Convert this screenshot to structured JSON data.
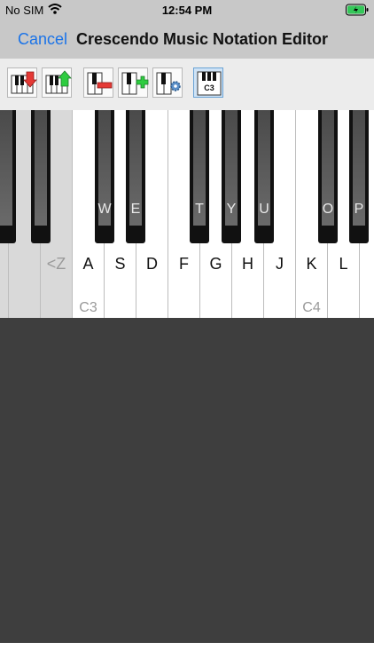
{
  "status": {
    "carrier": "No SIM",
    "time": "12:54 PM"
  },
  "nav": {
    "cancel": "Cancel",
    "title": "Crescendo Music Notation Editor"
  },
  "toolbar": {
    "buttons": [
      {
        "icon": "piano-down-icon"
      },
      {
        "icon": "piano-up-icon"
      },
      {
        "icon": "piano-remove-icon"
      },
      {
        "icon": "piano-add-icon"
      },
      {
        "icon": "piano-settings-icon"
      },
      {
        "icon": "piano-c3-icon",
        "label": "C3",
        "active": true
      }
    ]
  },
  "keyboard": {
    "shortcut_prev": "<Z",
    "white_keys": [
      "A",
      "S",
      "D",
      "F",
      "G",
      "H",
      "J",
      "K",
      "L"
    ],
    "black_keys": [
      "W",
      "E",
      "T",
      "Y",
      "U",
      "O",
      "P"
    ],
    "octave_labels": [
      "C3",
      "C4"
    ]
  },
  "colors": {
    "accent": "#1a73e8",
    "canvas": "#3e3e3e"
  }
}
